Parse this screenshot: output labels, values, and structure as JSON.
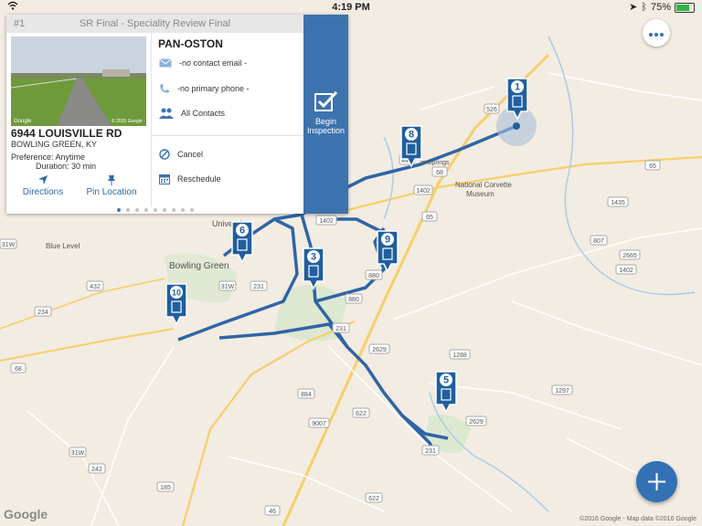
{
  "status_bar": {
    "time": "4:19 PM",
    "battery": "75%",
    "battery_level": 0.75
  },
  "card": {
    "index": "#1",
    "title": "SR Final - Speciality Review Final",
    "address": "6944 LOUISVILLE RD",
    "city": "BOWLING GREEN, KY",
    "preference": "Preference: Anytime",
    "duration": "Duration: 30 min",
    "directions_label": "Directions",
    "pin_label": "Pin Location",
    "company": "PAN-OSTON",
    "email": "-no contact email -",
    "phone": "-no primary phone -",
    "contacts": "All Contacts",
    "cancel": "Cancel",
    "reschedule": "Reschedule",
    "begin_line1": "Begin",
    "begin_line2": "Inspection",
    "photo_credit": "Google",
    "photo_copyright": "© 2015 Google",
    "page_count": 9,
    "page_active": 1
  },
  "map": {
    "labels": {
      "city": "Bowling Green",
      "university": "University",
      "blue_level": "Blue Level",
      "museum1": "National Corvette",
      "museum2": "Museum",
      "springs": "m Springs"
    },
    "markers": [
      "1",
      "8",
      "6",
      "3",
      "9",
      "10",
      "5"
    ],
    "shields": [
      "526",
      "446",
      "65",
      "68",
      "1402",
      "65",
      "31W",
      "231",
      "880",
      "231",
      "2629",
      "1288",
      "884",
      "9007",
      "622",
      "31W",
      "242",
      "231",
      "2629",
      "185",
      "1435",
      "807",
      "2665",
      "1402",
      "432",
      "68",
      "31W",
      "234",
      "880",
      "622",
      "46",
      "1297",
      "1402"
    ],
    "colors": {
      "route": "#2f65a6",
      "marker": "#1f5f9f",
      "accent": "#3a7ab8"
    },
    "logo": "Google",
    "attribution": "©2016 Google - Map data ©2016 Google"
  },
  "icons": {
    "more": "more-dots-icon",
    "add": "plus-icon",
    "email": "envelope-icon",
    "phone": "phone-icon",
    "contacts": "people-icon",
    "cancel": "cancel-circle-icon",
    "reschedule": "calendar-icon",
    "begin": "checkbox-icon",
    "directions": "navigation-arrow-icon",
    "pin": "pushpin-icon"
  }
}
